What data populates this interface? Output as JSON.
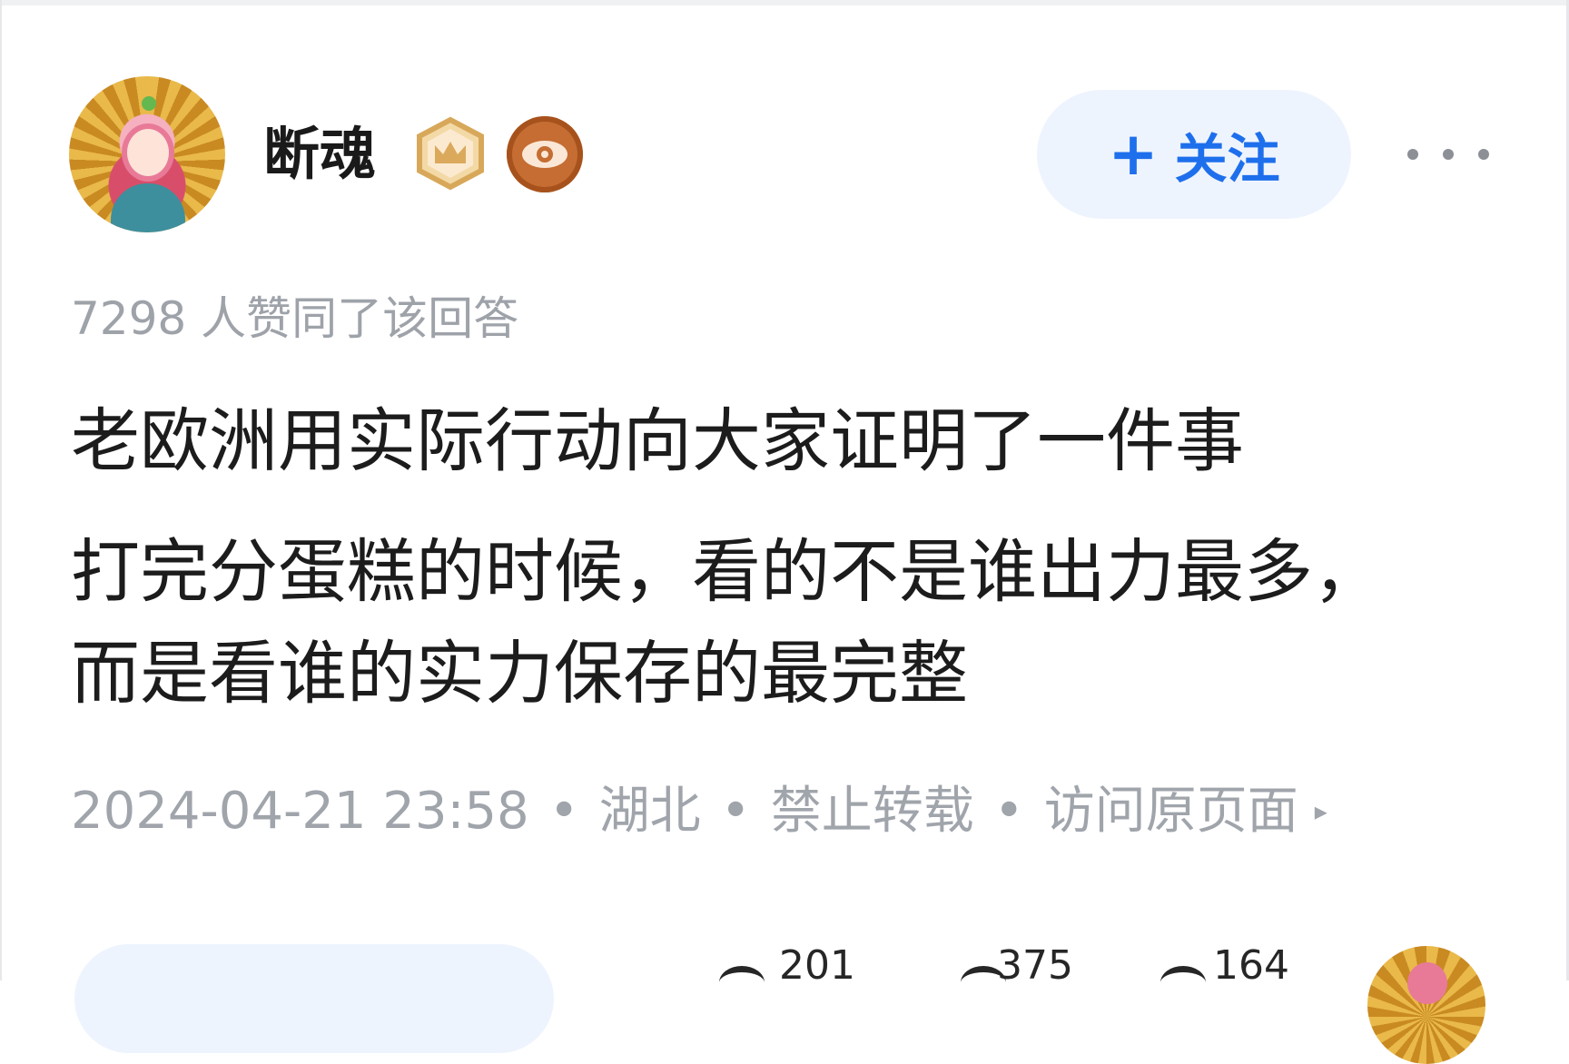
{
  "author": {
    "name": "断魂",
    "badges": [
      "crown-badge-icon",
      "eye-badge-icon"
    ]
  },
  "actions": {
    "follow_plus": "+",
    "follow_label": "关注",
    "more_icon": "more-horizontal-icon"
  },
  "answer": {
    "upvote_summary": "7298 人赞同了该回答",
    "lines": [
      "老欧洲用实际行动向大家证明了一件事",
      "打完分蛋糕的时候，看的不是谁出力最多，",
      "而是看谁的实力保存的最完整"
    ]
  },
  "meta": {
    "datetime": "2024-04-21 23:58",
    "separator": "•",
    "location": "湖北",
    "copyright": "禁止转载",
    "visit_link": "访问原页面",
    "arrow": "▸"
  },
  "footer_stats": {
    "stat1": "201",
    "stat2": "375",
    "stat3": "164"
  },
  "colors": {
    "accent": "#1e6fec",
    "follow_bg": "#eef4fe",
    "muted_text": "#a0a4ab"
  }
}
